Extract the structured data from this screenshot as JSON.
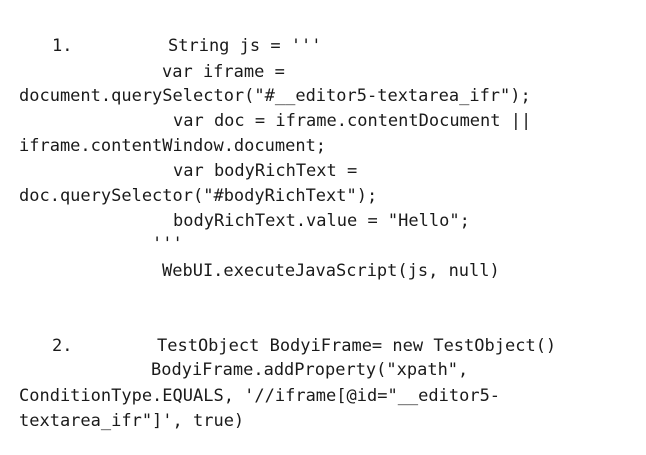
{
  "items": [
    {
      "number": "1.",
      "lines": [
        "String js = '''",
        "var iframe =",
        "document.querySelector(\"#__editor5-textarea_ifr\");",
        "var doc = iframe.contentDocument ||",
        "iframe.contentWindow.document;",
        "var bodyRichText =",
        "doc.querySelector(\"#bodyRichText\");",
        "bodyRichText.value = \"Hello\";",
        "'''",
        "WebUI.executeJavaScript(js, null)"
      ]
    },
    {
      "number": "2.",
      "lines": [
        "TestObject BodyiFrame= new TestObject()",
        "BodyiFrame.addProperty(\"xpath\",",
        "ConditionType.EQUALS, '//iframe[@id=\"__editor5-",
        "textarea_ifr\"]', true)"
      ]
    }
  ]
}
